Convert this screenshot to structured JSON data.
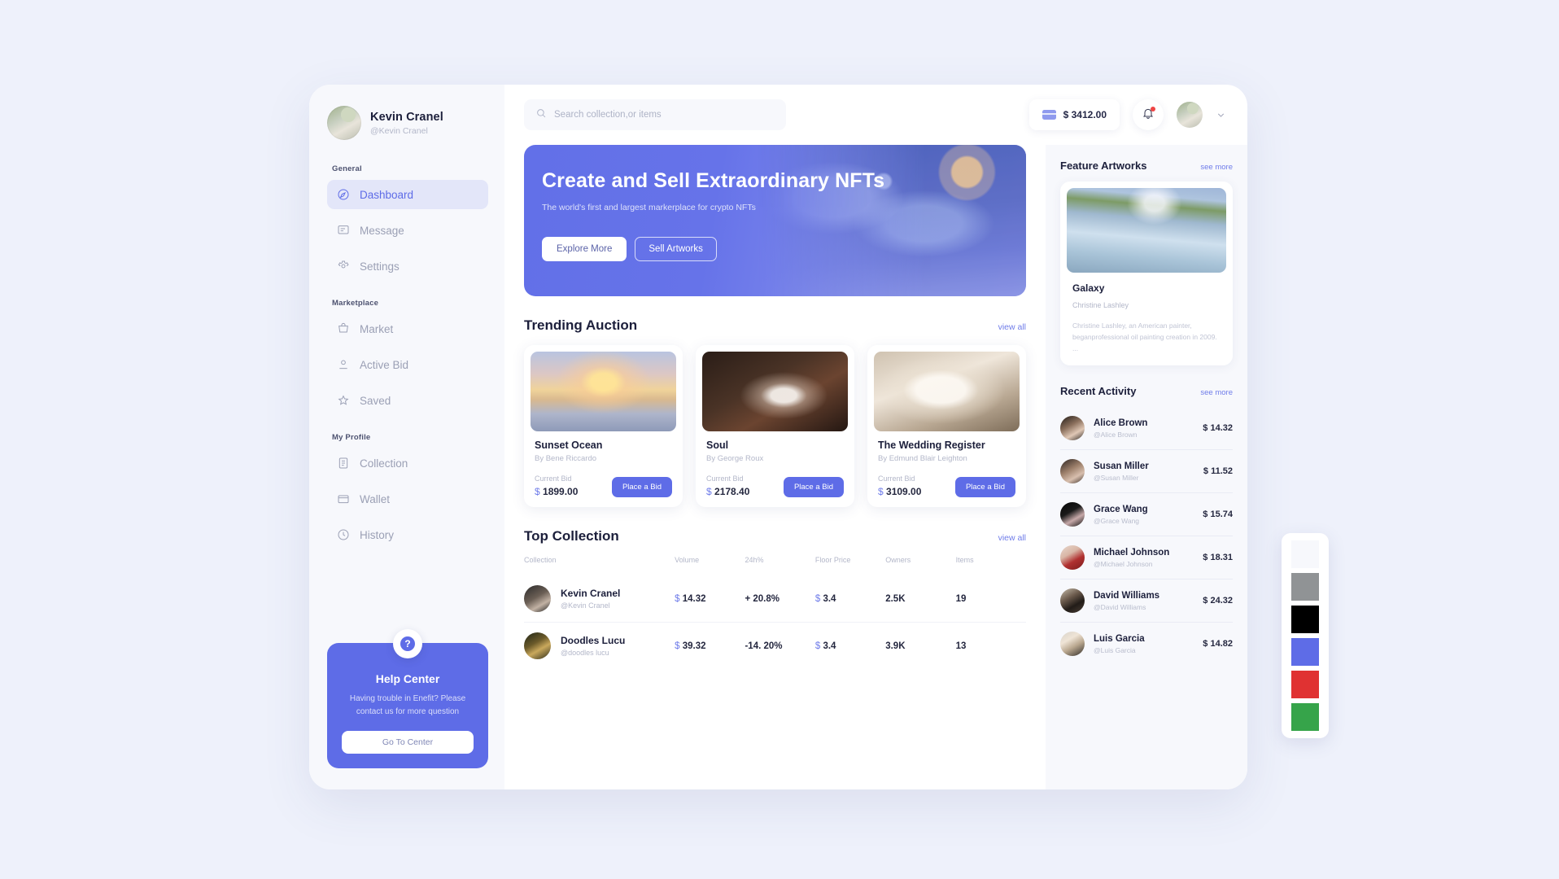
{
  "sidebar": {
    "profile": {
      "name": "Kevin Cranel",
      "handle": "@Kevin Cranel"
    },
    "sections": [
      {
        "label": "General",
        "items": [
          {
            "label": "Dashboard",
            "icon": "compass-icon",
            "active": true
          },
          {
            "label": "Message",
            "icon": "message-icon",
            "active": false
          },
          {
            "label": "Settings",
            "icon": "gear-icon",
            "active": false
          }
        ]
      },
      {
        "label": "Marketplace",
        "items": [
          {
            "label": "Market",
            "icon": "cart-icon",
            "active": false
          },
          {
            "label": "Active Bid",
            "icon": "user-icon",
            "active": false
          },
          {
            "label": "Saved",
            "icon": "star-icon",
            "active": false
          }
        ]
      },
      {
        "label": "My Profile",
        "items": [
          {
            "label": "Collection",
            "icon": "list-icon",
            "active": false
          },
          {
            "label": "Wallet",
            "icon": "wallet-icon",
            "active": false
          },
          {
            "label": "History",
            "icon": "clock-icon",
            "active": false
          }
        ]
      }
    ],
    "help": {
      "badge": "?",
      "title": "Help Center",
      "text": "Having trouble in Enefit? Please contact us for more question",
      "button": "Go To Center"
    }
  },
  "topbar": {
    "search_placeholder": "Search collection,or items",
    "balance": "$ 3412.00"
  },
  "hero": {
    "title": "Create and Sell Extraordinary NFTs",
    "subtitle": "The world's first and largest markerplace for crypto NFTs",
    "primary_button": "Explore More",
    "secondary_button": "Sell Artworks"
  },
  "trending": {
    "title": "Trending Auction",
    "view_all": "view all",
    "bid_label": "Current Bid",
    "bid_button": "Place a Bid",
    "currency": "$",
    "items": [
      {
        "name": "Sunset Ocean",
        "by": "By Bene Riccardo",
        "bid": "1899.00"
      },
      {
        "name": "Soul",
        "by": "By George Roux",
        "bid": "2178.40"
      },
      {
        "name": "The Wedding Register",
        "by": "By Edmund Blair Leighton",
        "bid": "3109.00"
      }
    ]
  },
  "top_collection": {
    "title": "Top Collection",
    "view_all": "view all",
    "columns": [
      "Collection",
      "Volume",
      "24h%",
      "Floor Price",
      "Owners",
      "Items"
    ],
    "rows": [
      {
        "name": "Kevin Cranel",
        "handle": "@Kevin Cranel",
        "volume": "14.32",
        "change": "+ 20.8%",
        "change_dir": "up",
        "floor": "3.4",
        "owners": "2.5K",
        "items": "19"
      },
      {
        "name": "Doodles Lucu",
        "handle": "@doodles lucu",
        "volume": "39.32",
        "change": "-14. 20%",
        "change_dir": "down",
        "floor": "3.4",
        "owners": "3.9K",
        "items": "13"
      }
    ]
  },
  "feature": {
    "title": "Feature Artworks",
    "see_more": "see more",
    "name": "Galaxy",
    "artist": "Christine Lashley",
    "description": "Christine Lashley, an American painter, beganprofessional oil painting creation in 2009. ..."
  },
  "activity": {
    "title": "Recent Activity",
    "see_more": "see more",
    "items": [
      {
        "name": "Alice Brown",
        "handle": "@Alice Brown",
        "amount": "$ 14.32"
      },
      {
        "name": "Susan Miller",
        "handle": "@Susan Miller",
        "amount": "$ 11.52"
      },
      {
        "name": "Grace Wang",
        "handle": "@Grace Wang",
        "amount": "$ 15.74"
      },
      {
        "name": "Michael Johnson",
        "handle": "@Michael Johnson",
        "amount": "$ 18.31"
      },
      {
        "name": "David Williams",
        "handle": "@David Williams",
        "amount": "$ 24.32"
      },
      {
        "name": "Luis Garcia",
        "handle": "@Luis Garcia",
        "amount": "$ 14.82"
      }
    ]
  },
  "palette": {
    "swatches": [
      "#f7f8fc",
      "#909395",
      "#000000",
      "#5e6ce7",
      "#e03232",
      "#36a44a"
    ]
  }
}
